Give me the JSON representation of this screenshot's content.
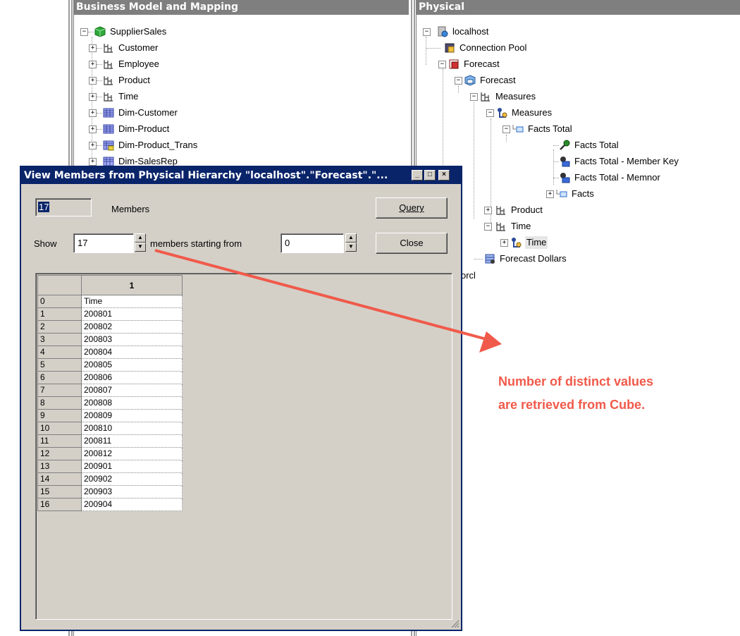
{
  "bmm_pane": {
    "title": "Business Model and Mapping",
    "items": [
      {
        "label": "SupplierSales",
        "icon": "cube-icon"
      },
      {
        "label": "Customer",
        "icon": "hierarchy-icon"
      },
      {
        "label": "Employee",
        "icon": "hierarchy-icon"
      },
      {
        "label": "Product",
        "icon": "hierarchy-icon"
      },
      {
        "label": "Time",
        "icon": "hierarchy-icon"
      },
      {
        "label": "Dim-Customer",
        "icon": "table-icon"
      },
      {
        "label": "Dim-Product",
        "icon": "table-icon"
      },
      {
        "label": "Dim-Product_Trans",
        "icon": "table-icon"
      },
      {
        "label": "Dim-SalesRep",
        "icon": "table-icon"
      }
    ]
  },
  "physical_pane": {
    "title": "Physical",
    "items": [
      {
        "label": "localhost",
        "icon": "database-icon"
      },
      {
        "label": "Connection Pool",
        "icon": "connection-pool-icon"
      },
      {
        "label": "Forecast",
        "icon": "catalog-icon"
      },
      {
        "label": "Forecast",
        "icon": "cube-schema-icon"
      },
      {
        "label": "Measures",
        "icon": "hierarchy-icon"
      },
      {
        "label": "Measures",
        "icon": "level-icon"
      },
      {
        "label": "Facts Total",
        "icon": "level-folder-icon"
      },
      {
        "label": "Facts Total",
        "icon": "key-icon"
      },
      {
        "label": "Facts Total - Member Key",
        "icon": "column-icon"
      },
      {
        "label": "Facts Total - Memnor",
        "icon": "column-icon"
      },
      {
        "label": "Facts",
        "icon": "level-folder-icon"
      },
      {
        "label": "Product",
        "icon": "hierarchy-icon"
      },
      {
        "label": "Time",
        "icon": "hierarchy-icon"
      },
      {
        "label": "Time",
        "icon": "level-icon"
      },
      {
        "label": "Forecast Dollars",
        "icon": "measure-icon"
      }
    ],
    "partial_label": "orcl"
  },
  "dialog": {
    "title": "View Members from Physical Hierarchy \"localhost\".\"Forecast\".\"...",
    "member_count": "17",
    "members_label": "Members",
    "query_button": "Query",
    "close_button": "Close",
    "show_label": "Show",
    "show_value": "17",
    "starting_label": "members starting from",
    "start_value": "0",
    "grid": {
      "column_header": "1",
      "rows": [
        {
          "index": "0",
          "value": "Time"
        },
        {
          "index": "1",
          "value": "200801"
        },
        {
          "index": "2",
          "value": "200802"
        },
        {
          "index": "3",
          "value": "200803"
        },
        {
          "index": "4",
          "value": "200804"
        },
        {
          "index": "5",
          "value": "200805"
        },
        {
          "index": "6",
          "value": "200806"
        },
        {
          "index": "7",
          "value": "200807"
        },
        {
          "index": "8",
          "value": "200808"
        },
        {
          "index": "9",
          "value": "200809"
        },
        {
          "index": "10",
          "value": "200810"
        },
        {
          "index": "11",
          "value": "200811"
        },
        {
          "index": "12",
          "value": "200812"
        },
        {
          "index": "13",
          "value": "200901"
        },
        {
          "index": "14",
          "value": "200902"
        },
        {
          "index": "15",
          "value": "200903"
        },
        {
          "index": "16",
          "value": "200904"
        }
      ]
    }
  },
  "annotation": {
    "line1": "Number of distinct values",
    "line2": "are retrieved from Cube.",
    "color": "#f05a4a"
  }
}
